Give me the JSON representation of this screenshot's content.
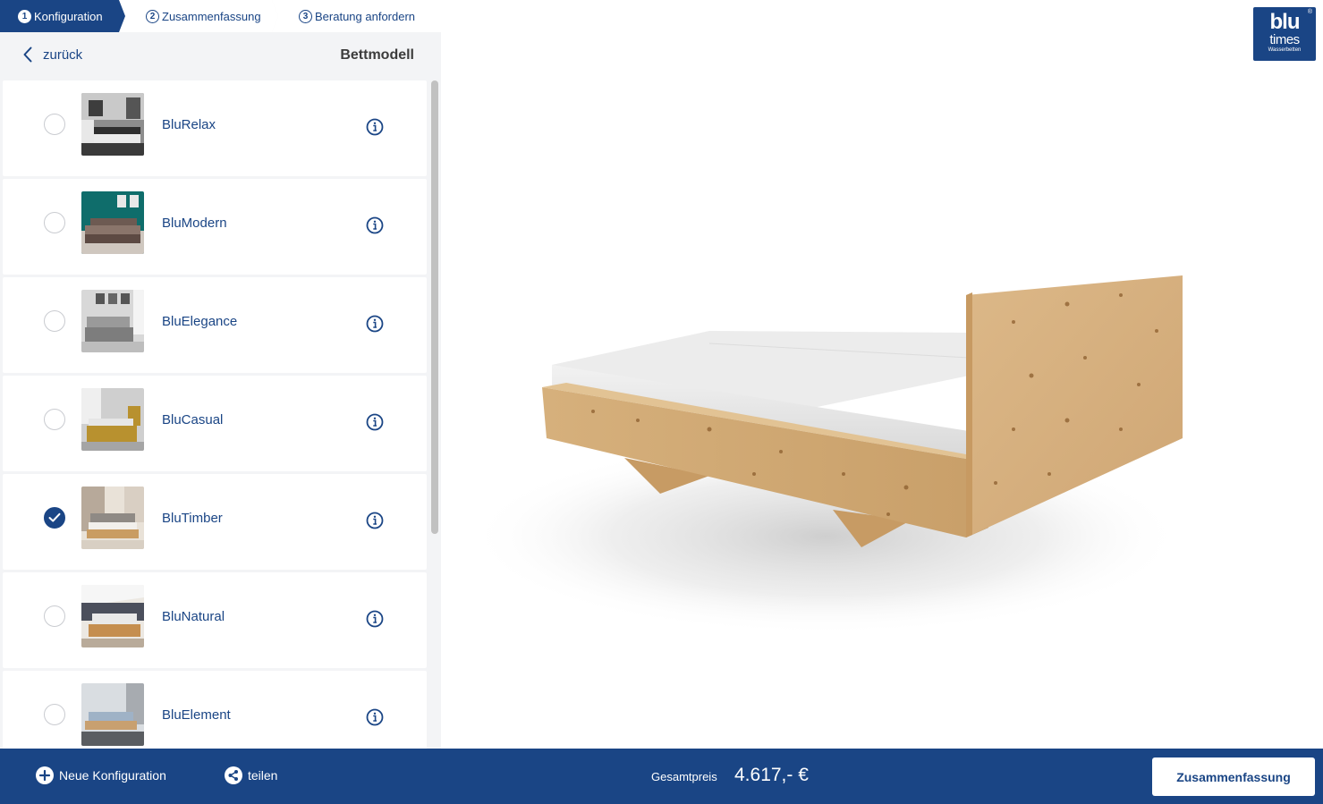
{
  "steps": [
    {
      "number": "1",
      "label": "Konfiguration"
    },
    {
      "number": "2",
      "label": "Zusammenfassung"
    },
    {
      "number": "3",
      "label": "Beratung anfordern"
    }
  ],
  "header": {
    "back_label": "zurück",
    "title": "Bettmodell"
  },
  "models": [
    {
      "name": "BluRelax",
      "selected": false
    },
    {
      "name": "BluModern",
      "selected": false
    },
    {
      "name": "BluElegance",
      "selected": false
    },
    {
      "name": "BluCasual",
      "selected": false
    },
    {
      "name": "BluTimber",
      "selected": true
    },
    {
      "name": "BluNatural",
      "selected": false
    },
    {
      "name": "BluElement",
      "selected": false
    }
  ],
  "logo": {
    "main": "blu",
    "sub": "times",
    "tagline": "Wasserbetten"
  },
  "bottom": {
    "new_config_label": "Neue Konfiguration",
    "share_label": "teilen",
    "total_label": "Gesamtpreis",
    "total_value": "4.617,- €",
    "summary_button": "Zusammenfassung"
  },
  "colors": {
    "brand": "#1a4585",
    "panel_bg": "#f3f4f6",
    "wood": "#d9b47e"
  }
}
